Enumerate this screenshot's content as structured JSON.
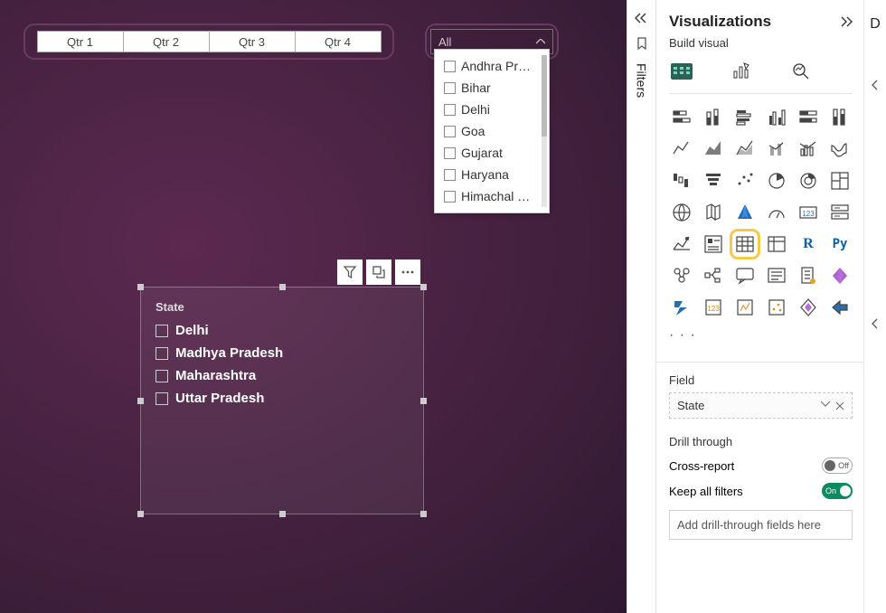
{
  "canvas": {
    "quarter_slicer": [
      "Qtr 1",
      "Qtr 2",
      "Qtr 3",
      "Qtr 4"
    ],
    "dropdown": {
      "selected": "All",
      "items": [
        "Andhra Pr…",
        "Bihar",
        "Delhi",
        "Goa",
        "Gujarat",
        "Haryana",
        "Himachal …"
      ]
    },
    "state_visual": {
      "title": "State",
      "items": [
        "Delhi",
        "Madhya Pradesh",
        "Maharashtra",
        "Uttar Pradesh"
      ]
    }
  },
  "filters_rail": {
    "label": "Filters"
  },
  "viz_pane": {
    "title": "Visualizations",
    "subtitle": "Build visual",
    "icons": [
      "stacked-bar",
      "stacked-column",
      "clustered-bar",
      "clustered-column",
      "100-bar",
      "100-column",
      "line",
      "area",
      "stacked-area",
      "line-stacked",
      "line-clustered",
      "ribbon",
      "waterfall",
      "funnel",
      "scatter",
      "pie",
      "donut",
      "treemap",
      "map",
      "filled-map",
      "azure-map",
      "gauge",
      "card",
      "multi-row",
      "kpi",
      "slicer",
      "table",
      "matrix",
      "r-visual",
      "py-visual",
      "key-influencers",
      "decomposition",
      "q-a",
      "smart-narrative",
      "paginated",
      "power-apps",
      "power-automate",
      "ai1",
      "ai2",
      "ai3",
      "ai4",
      "arrow"
    ],
    "highlighted_index": 26,
    "ellipsis": "· · ·",
    "field_label": "Field",
    "field_value": "State",
    "drill": {
      "title": "Drill through",
      "cross_report": {
        "label": "Cross-report",
        "state": "Off"
      },
      "keep_filters": {
        "label": "Keep all filters",
        "state": "On"
      },
      "placeholder": "Add drill-through fields here"
    }
  },
  "right_edge": {
    "letter": "D"
  }
}
